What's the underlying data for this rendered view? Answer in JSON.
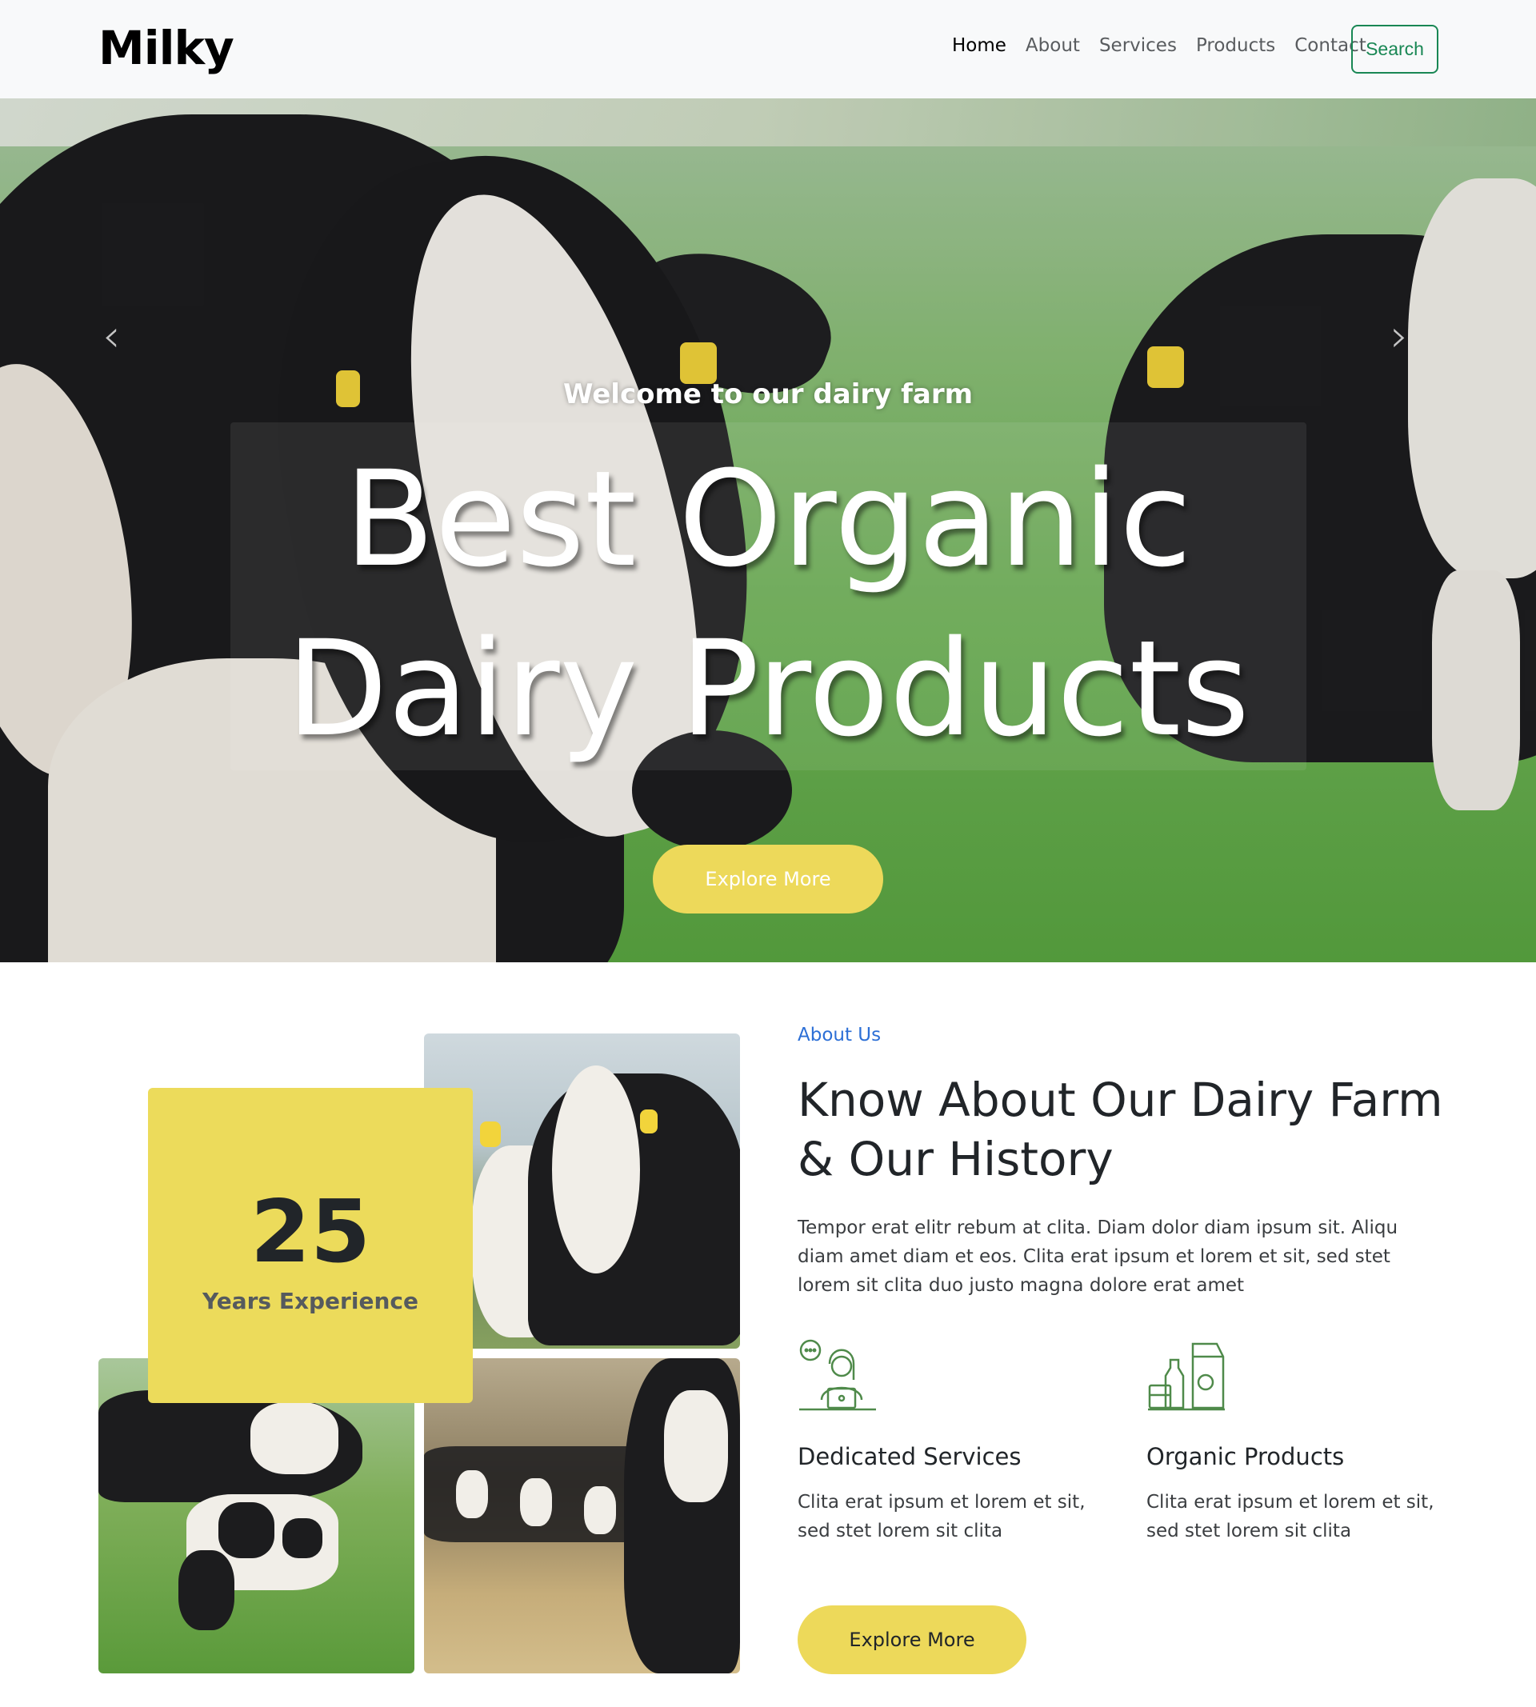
{
  "navbar": {
    "brand": "Milky",
    "items": [
      {
        "label": "Home",
        "active": true
      },
      {
        "label": "About",
        "active": false
      },
      {
        "label": "Services",
        "active": false
      },
      {
        "label": "Products",
        "active": false
      },
      {
        "label": "Contact",
        "active": false
      }
    ],
    "search_label": "Search"
  },
  "hero": {
    "subtitle": "Welcome to our dairy farm",
    "title_line1": "Best Organic",
    "title_line2": "Dairy Products",
    "button_label": "Explore More",
    "prev_icon": "chevron-left-icon",
    "next_icon": "chevron-right-icon"
  },
  "experience": {
    "number": "25",
    "label": "Years Experience"
  },
  "about": {
    "tag": "About Us",
    "title": "Know About Our Dairy Farm & Our History",
    "description": "Tempor erat elitr rebum at clita. Diam dolor diam ipsum sit. Aliqu diam amet diam et eos. Clita erat ipsum et lorem et sit, sed stet lorem sit clita duo justo magna dolore erat amet",
    "features": [
      {
        "icon": "customer-support-icon",
        "title": "Dedicated Services",
        "description": "Clita erat ipsum et lorem et sit, sed stet lorem sit clita"
      },
      {
        "icon": "dairy-products-icon",
        "title": "Organic Products",
        "description": "Clita erat ipsum et lorem et sit, sed stet lorem sit clita"
      }
    ],
    "button_label": "Explore More"
  },
  "colors": {
    "accent_yellow": "#edd95a",
    "success_green": "#198754",
    "link_blue": "#2c6fd6",
    "icon_green": "#4f8a4a"
  }
}
